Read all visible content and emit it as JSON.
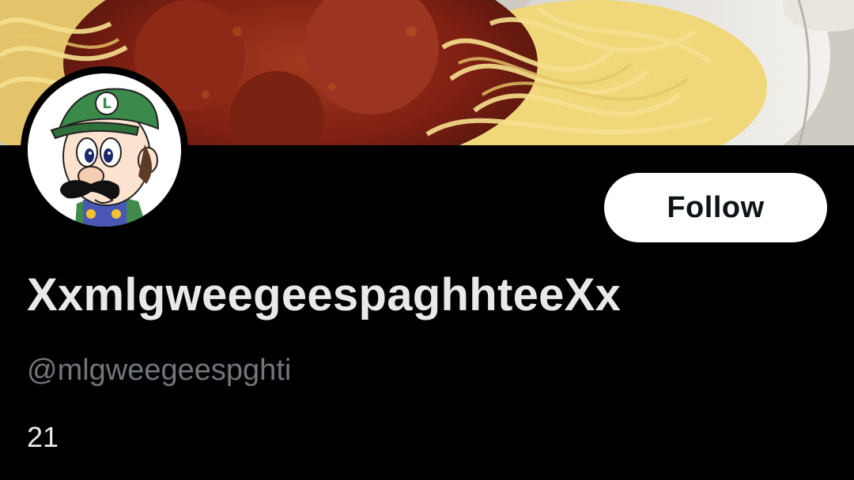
{
  "profile": {
    "display_name": "XxmlgweegeespaghhteeXx",
    "handle": "@mlgweegeespghti",
    "bio": "21",
    "banner_image": "spaghetti-and-meatballs",
    "avatar_image": "weegee-cartoon"
  },
  "actions": {
    "follow_label": "Follow"
  },
  "colors": {
    "background": "#000000",
    "primary_text": "#e7e9ea",
    "secondary_text": "#71767b",
    "button_bg": "#ffffff",
    "button_text": "#0f1419"
  }
}
